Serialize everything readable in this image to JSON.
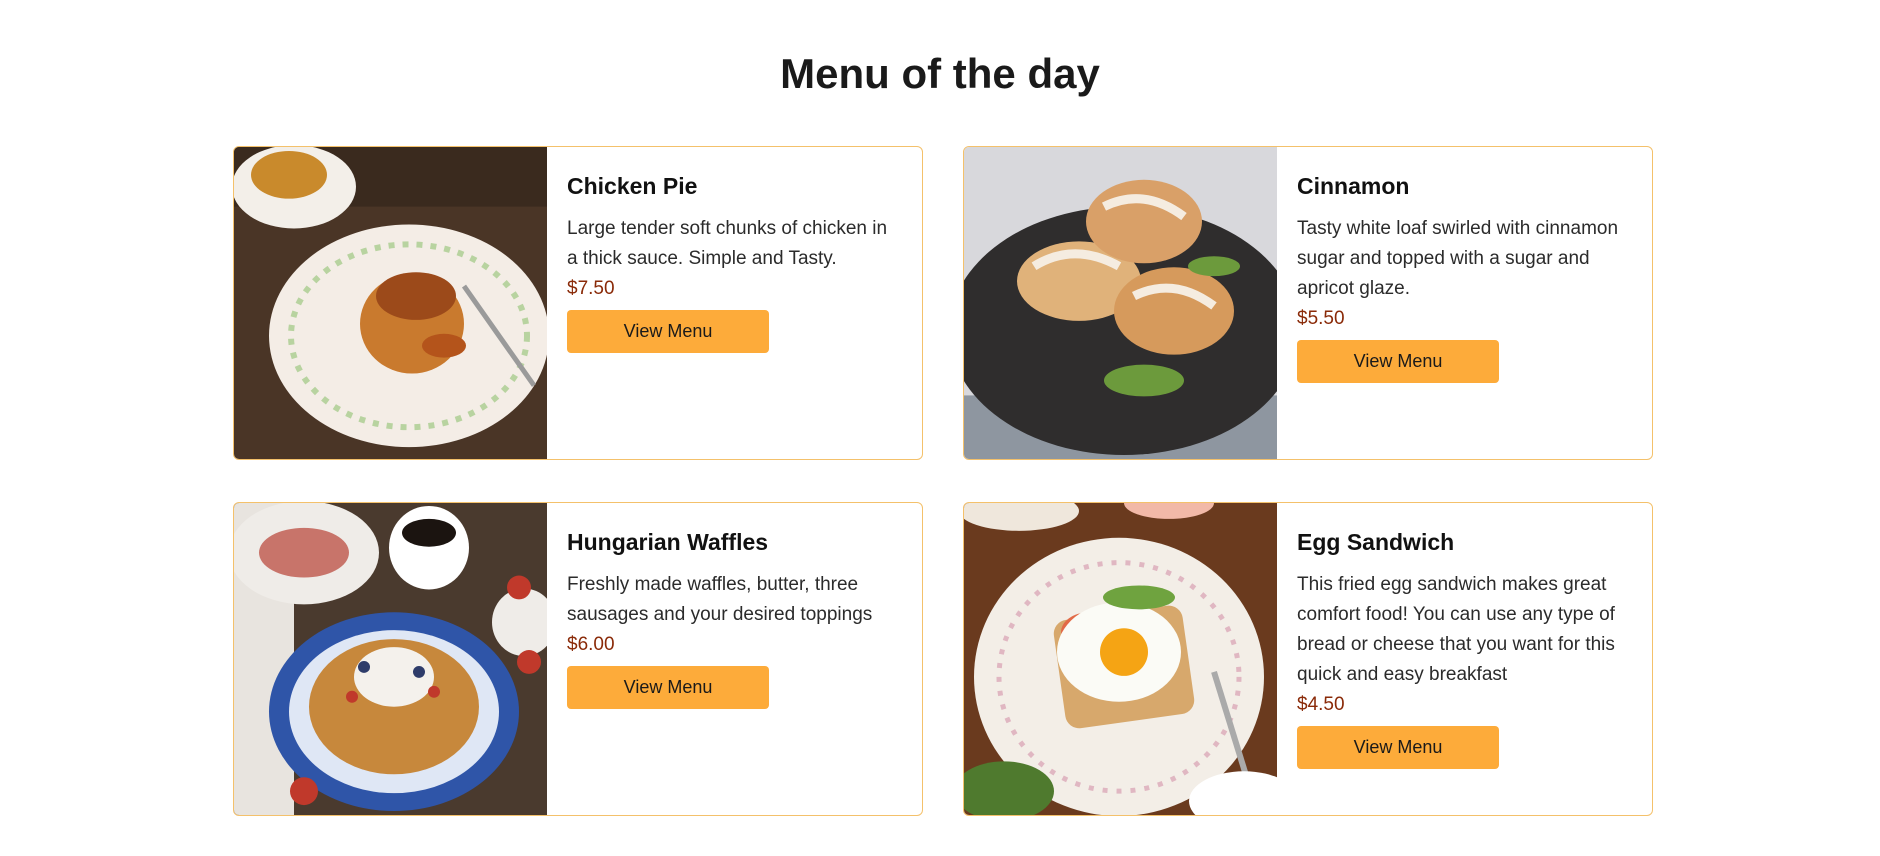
{
  "page": {
    "title": "Menu of the day"
  },
  "items": [
    {
      "name": "Chicken Pie",
      "description": "Large tender soft chunks of chicken in a thick sauce. Simple and Tasty.",
      "price": "$7.50",
      "button_label": "View Menu",
      "image": "chicken-pie-photo"
    },
    {
      "name": "Cinnamon",
      "description": "Tasty white loaf swirled with cinnamon sugar and topped with a sugar and apricot glaze.",
      "price": "$5.50",
      "button_label": "View Menu",
      "image": "cinnamon-bread-photo"
    },
    {
      "name": "Hungarian Waffles",
      "description": "Freshly made waffles, butter, three sausages and your desired toppings",
      "price": "$6.00",
      "button_label": "View Menu",
      "image": "waffles-photo"
    },
    {
      "name": "Egg Sandwich",
      "description": "This fried egg sandwich makes great comfort food! You can use any type of bread or cheese that you want for this quick and easy breakfast",
      "price": "$4.50",
      "button_label": "View Menu",
      "image": "egg-sandwich-photo"
    }
  ],
  "colors": {
    "accent": "#fdab3a",
    "border": "#f4c16b",
    "price": "#8a2a08"
  }
}
